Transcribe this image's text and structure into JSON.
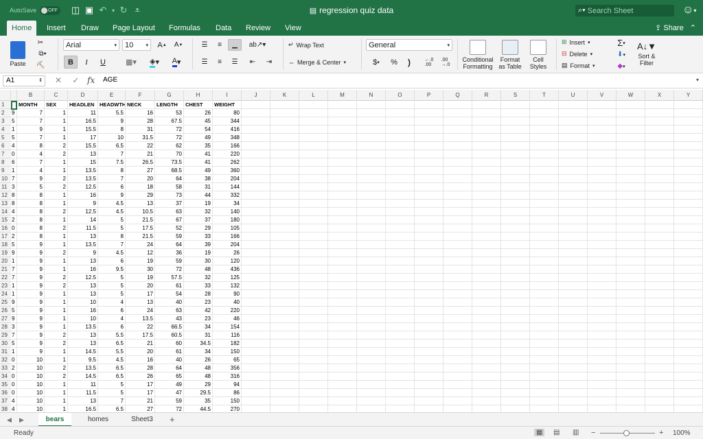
{
  "titlebar": {
    "autosave_label": "AutoSave",
    "autosave_state": "OFF",
    "doc_title": "regression quiz data",
    "search_placeholder": "Search Sheet",
    "qa_icons": [
      "sidebar-icon",
      "save-icon",
      "undo-icon",
      "redo-icon",
      "customize-icon"
    ]
  },
  "tabs": [
    "Home",
    "Insert",
    "Draw",
    "Page Layout",
    "Formulas",
    "Data",
    "Review",
    "View"
  ],
  "active_tab": "Home",
  "share_label": "Share",
  "ribbon": {
    "paste": "Paste",
    "font_name": "Arial",
    "font_size": "10",
    "bold": "B",
    "italic": "I",
    "underline": "U",
    "wrap_text": "Wrap Text",
    "merge_center": "Merge & Center",
    "number_format": "General",
    "currency": "$",
    "percent": "%",
    "comma": ")",
    "inc_decimal": ".00→.0",
    "dec_decimal": ".00",
    "conditional_formatting": [
      "Conditional",
      "Formatting"
    ],
    "format_as_table": [
      "Format",
      "as Table"
    ],
    "cell_styles": [
      "Cell",
      "Styles"
    ],
    "insert": "Insert",
    "delete": "Delete",
    "format": "Format",
    "sort_filter": [
      "Sort &",
      "Filter"
    ],
    "accent": "#217346",
    "fill_color": "#3fd1e5",
    "font_color": "#1f3fd6"
  },
  "formula_bar": {
    "name_box": "A1",
    "fx": "fx",
    "content": "AGE"
  },
  "columns": [
    "B",
    "C",
    "D",
    "E",
    "F",
    "G",
    "H",
    "I",
    "J",
    "K",
    "L",
    "M",
    "N",
    "O",
    "P",
    "Q",
    "R",
    "S",
    "T",
    "U",
    "V",
    "W",
    "X",
    "Y"
  ],
  "header_row": {
    "row_num": "1",
    "a": "",
    "cells": [
      "MONTH",
      "SEX",
      "HEADLEN",
      "HEADWTH",
      "NECK",
      "LENGTH",
      "CHEST",
      "WEIGHT"
    ]
  },
  "rows": [
    {
      "n": "2",
      "a": "9",
      "v": [
        "7",
        "1",
        "11",
        "5.5",
        "16",
        "53",
        "26",
        "80"
      ]
    },
    {
      "n": "3",
      "a": "5",
      "v": [
        "7",
        "1",
        "16.5",
        "9",
        "28",
        "67.5",
        "45",
        "344"
      ]
    },
    {
      "n": "4",
      "a": "1",
      "v": [
        "9",
        "1",
        "15.5",
        "8",
        "31",
        "72",
        "54",
        "416"
      ]
    },
    {
      "n": "5",
      "a": "5",
      "v": [
        "7",
        "1",
        "17",
        "10",
        "31.5",
        "72",
        "49",
        "348"
      ]
    },
    {
      "n": "6",
      "a": "4",
      "v": [
        "8",
        "2",
        "15.5",
        "6.5",
        "22",
        "62",
        "35",
        "166"
      ]
    },
    {
      "n": "7",
      "a": "0",
      "v": [
        "4",
        "2",
        "13",
        "7",
        "21",
        "70",
        "41",
        "220"
      ]
    },
    {
      "n": "8",
      "a": "6",
      "v": [
        "7",
        "1",
        "15",
        "7.5",
        "26.5",
        "73.5",
        "41",
        "262"
      ]
    },
    {
      "n": "9",
      "a": "1",
      "v": [
        "4",
        "1",
        "13.5",
        "8",
        "27",
        "68.5",
        "49",
        "360"
      ]
    },
    {
      "n": "10",
      "a": "7",
      "v": [
        "9",
        "2",
        "13.5",
        "7",
        "20",
        "64",
        "38",
        "204"
      ]
    },
    {
      "n": "11",
      "a": "3",
      "v": [
        "5",
        "2",
        "12.5",
        "6",
        "18",
        "58",
        "31",
        "144"
      ]
    },
    {
      "n": "12",
      "a": "8",
      "v": [
        "8",
        "1",
        "16",
        "9",
        "29",
        "73",
        "44",
        "332"
      ]
    },
    {
      "n": "13",
      "a": "8",
      "v": [
        "8",
        "1",
        "9",
        "4.5",
        "13",
        "37",
        "19",
        "34"
      ]
    },
    {
      "n": "14",
      "a": "4",
      "v": [
        "8",
        "2",
        "12.5",
        "4.5",
        "10.5",
        "63",
        "32",
        "140"
      ]
    },
    {
      "n": "15",
      "a": "2",
      "v": [
        "8",
        "1",
        "14",
        "5",
        "21.5",
        "67",
        "37",
        "180"
      ]
    },
    {
      "n": "16",
      "a": "0",
      "v": [
        "8",
        "2",
        "11.5",
        "5",
        "17.5",
        "52",
        "29",
        "105"
      ]
    },
    {
      "n": "17",
      "a": "2",
      "v": [
        "8",
        "1",
        "13",
        "8",
        "21.5",
        "59",
        "33",
        "166"
      ]
    },
    {
      "n": "18",
      "a": "5",
      "v": [
        "9",
        "1",
        "13.5",
        "7",
        "24",
        "64",
        "39",
        "204"
      ]
    },
    {
      "n": "19",
      "a": "9",
      "v": [
        "9",
        "2",
        "9",
        "4.5",
        "12",
        "36",
        "19",
        "26"
      ]
    },
    {
      "n": "20",
      "a": "1",
      "v": [
        "9",
        "1",
        "13",
        "6",
        "19",
        "59",
        "30",
        "120"
      ]
    },
    {
      "n": "21",
      "a": "7",
      "v": [
        "9",
        "1",
        "16",
        "9.5",
        "30",
        "72",
        "48",
        "436"
      ]
    },
    {
      "n": "22",
      "a": "7",
      "v": [
        "9",
        "2",
        "12.5",
        "5",
        "19",
        "57.5",
        "32",
        "125"
      ]
    },
    {
      "n": "23",
      "a": "1",
      "v": [
        "9",
        "2",
        "13",
        "5",
        "20",
        "61",
        "33",
        "132"
      ]
    },
    {
      "n": "24",
      "a": "1",
      "v": [
        "9",
        "1",
        "13",
        "5",
        "17",
        "54",
        "28",
        "90"
      ]
    },
    {
      "n": "25",
      "a": "9",
      "v": [
        "9",
        "1",
        "10",
        "4",
        "13",
        "40",
        "23",
        "40"
      ]
    },
    {
      "n": "26",
      "a": "5",
      "v": [
        "9",
        "1",
        "16",
        "6",
        "24",
        "63",
        "42",
        "220"
      ]
    },
    {
      "n": "27",
      "a": "9",
      "v": [
        "9",
        "1",
        "10",
        "4",
        "13.5",
        "43",
        "23",
        "46"
      ]
    },
    {
      "n": "28",
      "a": "3",
      "v": [
        "9",
        "1",
        "13.5",
        "6",
        "22",
        "66.5",
        "34",
        "154"
      ]
    },
    {
      "n": "29",
      "a": "7",
      "v": [
        "9",
        "2",
        "13",
        "5.5",
        "17.5",
        "60.5",
        "31",
        "116"
      ]
    },
    {
      "n": "30",
      "a": "5",
      "v": [
        "9",
        "2",
        "13",
        "6.5",
        "21",
        "60",
        "34.5",
        "182"
      ]
    },
    {
      "n": "31",
      "a": "1",
      "v": [
        "9",
        "1",
        "14.5",
        "5.5",
        "20",
        "61",
        "34",
        "150"
      ]
    },
    {
      "n": "32",
      "a": "0",
      "v": [
        "10",
        "1",
        "9.5",
        "4.5",
        "16",
        "40",
        "26",
        "65"
      ]
    },
    {
      "n": "33",
      "a": "2",
      "v": [
        "10",
        "2",
        "13.5",
        "6.5",
        "28",
        "64",
        "48",
        "356"
      ]
    },
    {
      "n": "34",
      "a": "0",
      "v": [
        "10",
        "2",
        "14.5",
        "6.5",
        "26",
        "65",
        "48",
        "316"
      ]
    },
    {
      "n": "35",
      "a": "0",
      "v": [
        "10",
        "1",
        "11",
        "5",
        "17",
        "49",
        "29",
        "94"
      ]
    },
    {
      "n": "36",
      "a": "0",
      "v": [
        "10",
        "1",
        "11.5",
        "5",
        "17",
        "47",
        "29.5",
        "86"
      ]
    },
    {
      "n": "37",
      "a": "4",
      "v": [
        "10",
        "1",
        "13",
        "7",
        "21",
        "59",
        "35",
        "150"
      ]
    },
    {
      "n": "38",
      "a": "4",
      "v": [
        "10",
        "1",
        "16.5",
        "6.5",
        "27",
        "72",
        "44.5",
        "270"
      ]
    }
  ],
  "sheets": [
    "bears",
    "homes",
    "Sheet3"
  ],
  "active_sheet": "bears",
  "status": "Ready",
  "zoom": "100%"
}
